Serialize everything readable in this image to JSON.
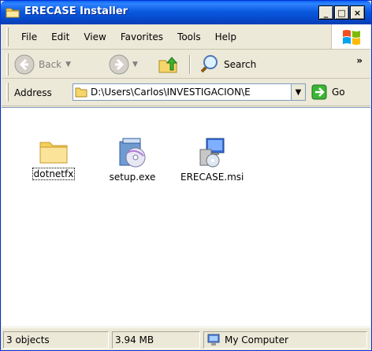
{
  "window": {
    "title": "ERECASE Installer",
    "title_bar_color": "#0a5ae0",
    "folder_icon": "folder-icon",
    "minimize_label": "_",
    "maximize_label": "□",
    "close_label": "×"
  },
  "menu": {
    "items": [
      "File",
      "Edit",
      "View",
      "Favorites",
      "Tools",
      "Help"
    ],
    "logo_icon": "windows-logo-icon"
  },
  "toolbar": {
    "back_label": "Back",
    "back_icon": "back-arrow-icon",
    "forward_icon": "forward-arrow-icon",
    "up_icon": "folder-up-icon",
    "search_label": "Search",
    "search_icon": "magnifier-icon",
    "overflow_label": "»"
  },
  "address": {
    "label": "Address",
    "value": "D:\\Users\\Carlos\\INVESTIGACION\\E",
    "go_label": "Go",
    "go_icon": "green-arrow-icon"
  },
  "files": [
    {
      "name": "dotnetfx",
      "icon": "folder-icon"
    },
    {
      "name": "setup.exe",
      "icon": "setup-exe-icon"
    },
    {
      "name": "ERECASE.msi",
      "icon": "msi-installer-icon"
    }
  ],
  "status": {
    "objects": "3 objects",
    "size": "3.94 MB",
    "zone": "My Computer",
    "zone_icon": "my-computer-icon"
  }
}
